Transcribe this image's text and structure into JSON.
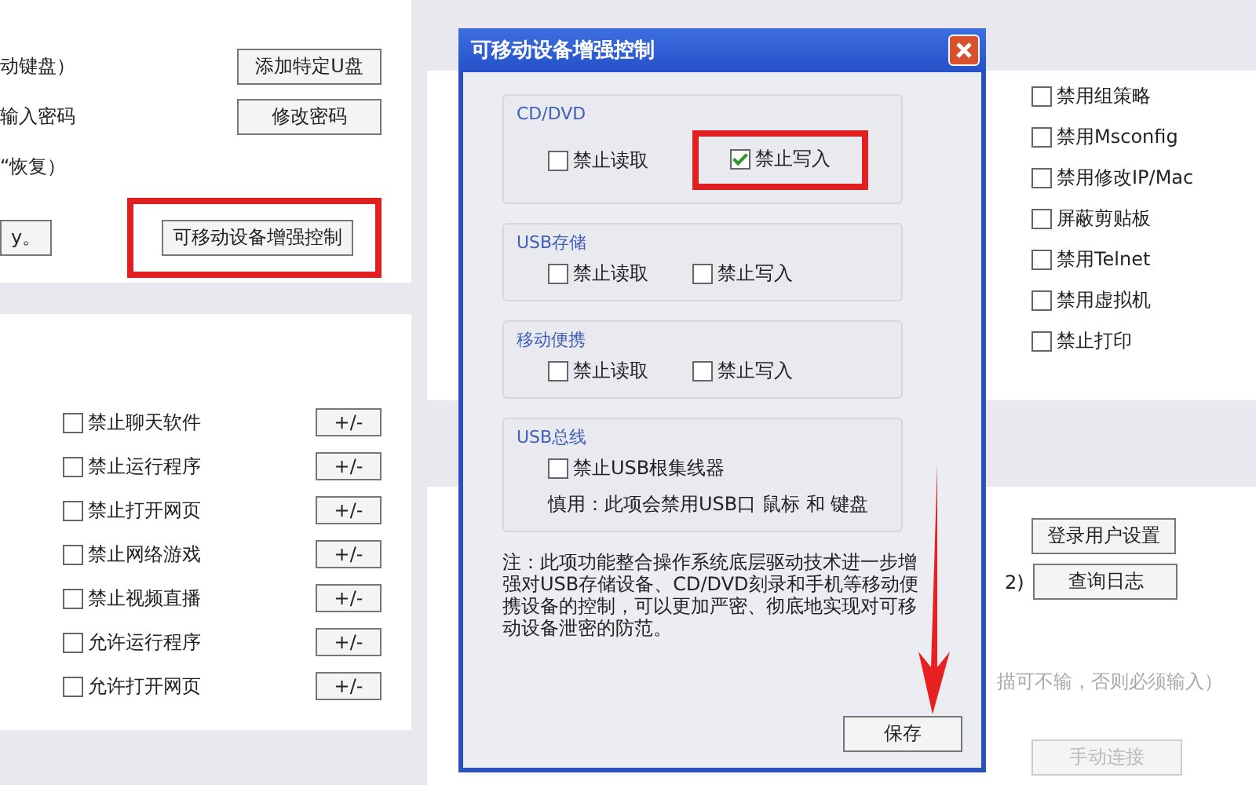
{
  "left_panel": {
    "rows": [
      {
        "label": "动键盘）",
        "button": "添加特定U盘",
        "highlighted": false
      },
      {
        "label": "输入密码",
        "button": "修改密码",
        "highlighted": false
      },
      {
        "label": "“恢复）"
      },
      {
        "partial_button": "y。",
        "button": "可移动设备增强控制",
        "highlighted": true
      }
    ]
  },
  "filters": [
    {
      "label": "禁止聊天软件",
      "checked": false,
      "button": "+/-"
    },
    {
      "label": "禁止运行程序",
      "checked": false,
      "button": "+/-"
    },
    {
      "label": "禁止打开网页",
      "checked": false,
      "button": "+/-"
    },
    {
      "label": "禁止网络游戏",
      "checked": false,
      "button": "+/-"
    },
    {
      "label": "禁止视频直播",
      "checked": false,
      "button": "+/-"
    },
    {
      "label": "允许运行程序",
      "checked": false,
      "button": "+/-"
    },
    {
      "label": "允许打开网页",
      "checked": false,
      "button": "+/-"
    }
  ],
  "right_panel": {
    "options": [
      {
        "label": "禁用组策略",
        "checked": false
      },
      {
        "label": "禁用Msconfig",
        "checked": false
      },
      {
        "label": "禁用修改IP/Mac",
        "checked": false
      },
      {
        "label": "屏蔽剪贴板",
        "checked": false
      },
      {
        "label": "禁用Telnet",
        "checked": false
      },
      {
        "label": "禁用虚拟机",
        "checked": false
      },
      {
        "label": "禁止打印",
        "checked": false
      }
    ]
  },
  "right_lower": {
    "side_text": "2)",
    "buttons": [
      "登录用户设置",
      "查询日志"
    ],
    "hint": "描可不输，否则必须输入）",
    "faded_button": "手动连接"
  },
  "dialog": {
    "title": "可移动设备增强控制",
    "groups": [
      {
        "title": "CD/DVD",
        "options": [
          {
            "label": "禁止读取",
            "checked": false,
            "highlighted": false
          },
          {
            "label": "禁止写入",
            "checked": true,
            "highlighted": true
          }
        ]
      },
      {
        "title": "USB存储",
        "options": [
          {
            "label": "禁止读取",
            "checked": false,
            "highlighted": false
          },
          {
            "label": "禁止写入",
            "checked": false,
            "highlighted": false
          }
        ]
      },
      {
        "title": "移动便携",
        "options": [
          {
            "label": "禁止读取",
            "checked": false,
            "highlighted": false
          },
          {
            "label": "禁止写入",
            "checked": false,
            "highlighted": false
          }
        ]
      },
      {
        "title": "USB总线",
        "options": [
          {
            "label": "禁止USB根集线器",
            "checked": false,
            "highlighted": false
          }
        ],
        "warning": "慎用：此项会禁用USB口 鼠标 和 键盘"
      }
    ],
    "note": "注：此项功能整合操作系统底层驱动技术进一步增强对USB存储设备、CD/DVD刻录和手机等移动便携设备的控制，可以更加严密、彻底地实现对可移动设备泄密的防范。",
    "save_button": "保存"
  }
}
